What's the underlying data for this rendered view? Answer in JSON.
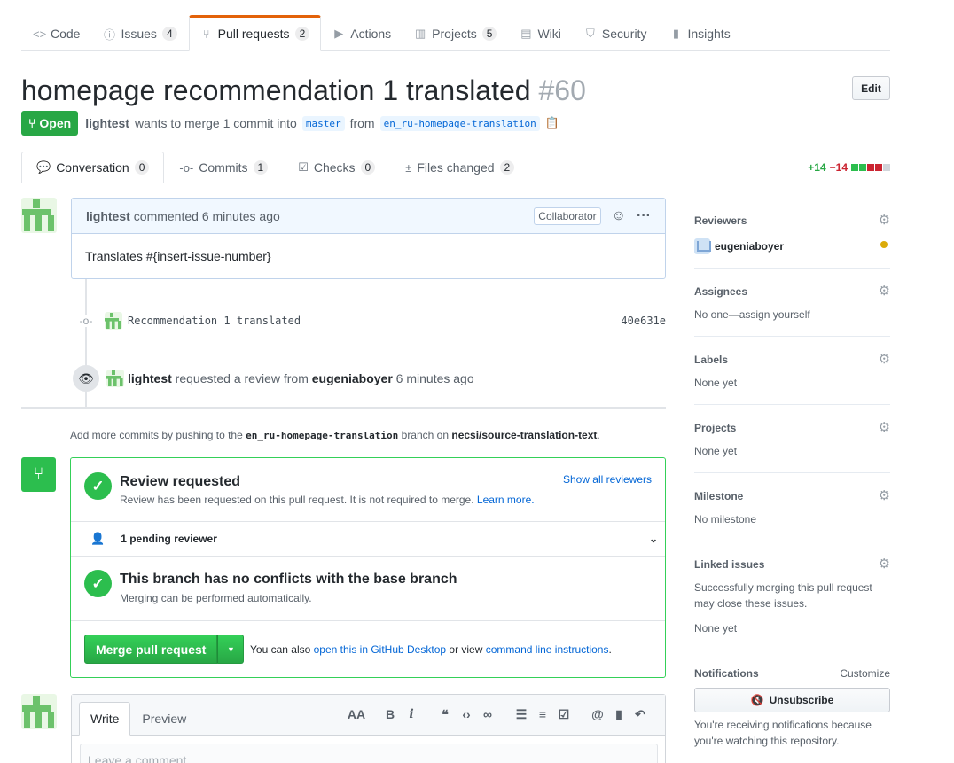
{
  "repo_nav": {
    "tabs": [
      {
        "label": "Code",
        "icon": "code-icon",
        "glyph": "<>",
        "count": null
      },
      {
        "label": "Issues",
        "icon": "issue-icon",
        "glyph": "ⓘ",
        "count": "4"
      },
      {
        "label": "Pull requests",
        "icon": "pull-request-icon",
        "glyph": "⑂",
        "count": "2"
      },
      {
        "label": "Actions",
        "icon": "play-icon",
        "glyph": "▶",
        "count": null
      },
      {
        "label": "Projects",
        "icon": "project-icon",
        "glyph": "▥",
        "count": "5"
      },
      {
        "label": "Wiki",
        "icon": "book-icon",
        "glyph": "▤",
        "count": null
      },
      {
        "label": "Security",
        "icon": "shield-icon",
        "glyph": "⛉",
        "count": null
      },
      {
        "label": "Insights",
        "icon": "graph-icon",
        "glyph": "▮",
        "count": null
      }
    ]
  },
  "pr": {
    "title": "homepage recommendation 1 translated",
    "number": "#60",
    "edit_label": "Edit",
    "state": "Open",
    "author": "lightest",
    "merge_text_1": "wants to merge 1 commit into",
    "base_branch": "master",
    "merge_text_2": "from",
    "head_branch": "en_ru-homepage-translation"
  },
  "pr_tabs": [
    {
      "label": "Conversation",
      "count": "0",
      "icon": "comment-icon",
      "glyph": "💬"
    },
    {
      "label": "Commits",
      "count": "1",
      "icon": "commit-icon",
      "glyph": "-o-"
    },
    {
      "label": "Checks",
      "count": "0",
      "icon": "checklist-icon",
      "glyph": "☑"
    },
    {
      "label": "Files changed",
      "count": "2",
      "icon": "diff-icon",
      "glyph": "±"
    }
  ],
  "diffstat": {
    "additions": "+14",
    "deletions": "−14",
    "colors": [
      "#2cbe4e",
      "#2cbe4e",
      "#cb2431",
      "#cb2431",
      "#d1d5da"
    ]
  },
  "comment": {
    "author": "lightest",
    "time": "commented 6 minutes ago",
    "role": "Collaborator",
    "body": "Translates #{insert-issue-number}"
  },
  "commit": {
    "message": "Recommendation 1 translated",
    "sha": "40e631e"
  },
  "review_event": {
    "actor": "lightest",
    "text": "requested a review from",
    "reviewer": "eugeniaboyer",
    "time": "6 minutes ago"
  },
  "push_note": {
    "text_1": "Add more commits by pushing to the",
    "branch": "en_ru-homepage-translation",
    "text_2": "branch on",
    "repo": "necsi/source-translation-text",
    "text_3": "."
  },
  "merge_box": {
    "review_title": "Review requested",
    "review_sub": "Review has been requested on this pull request. It is not required to merge.",
    "learn_more": "Learn more.",
    "show_all": "Show all reviewers",
    "pending": "1 pending reviewer",
    "conflict_title": "This branch has no conflicts with the base branch",
    "conflict_sub": "Merging can be performed automatically.",
    "merge_button": "Merge pull request",
    "also_text": "You can also",
    "desktop_link": "open this in GitHub Desktop",
    "or_view": "or view",
    "cli_link": "command line instructions",
    "period": "."
  },
  "new_comment": {
    "write_tab": "Write",
    "preview_tab": "Preview",
    "placeholder": "Leave a comment"
  },
  "sidebar": {
    "reviewers_heading": "Reviewers",
    "reviewer_name": "eugeniaboyer",
    "assignees_heading": "Assignees",
    "assignees_text": "No one—assign yourself",
    "labels_heading": "Labels",
    "labels_text": "None yet",
    "projects_heading": "Projects",
    "projects_text": "None yet",
    "milestone_heading": "Milestone",
    "milestone_text": "No milestone",
    "linked_heading": "Linked issues",
    "linked_desc_1": "Successfully merging this pull request",
    "linked_desc_2": "may close these issues.",
    "linked_text": "None yet",
    "notifications_heading": "Notifications",
    "customize": "Customize",
    "unsubscribe": "Unsubscribe",
    "notif_desc_1": "You're receiving notifications because",
    "notif_desc_2": "you're watching this repository."
  }
}
